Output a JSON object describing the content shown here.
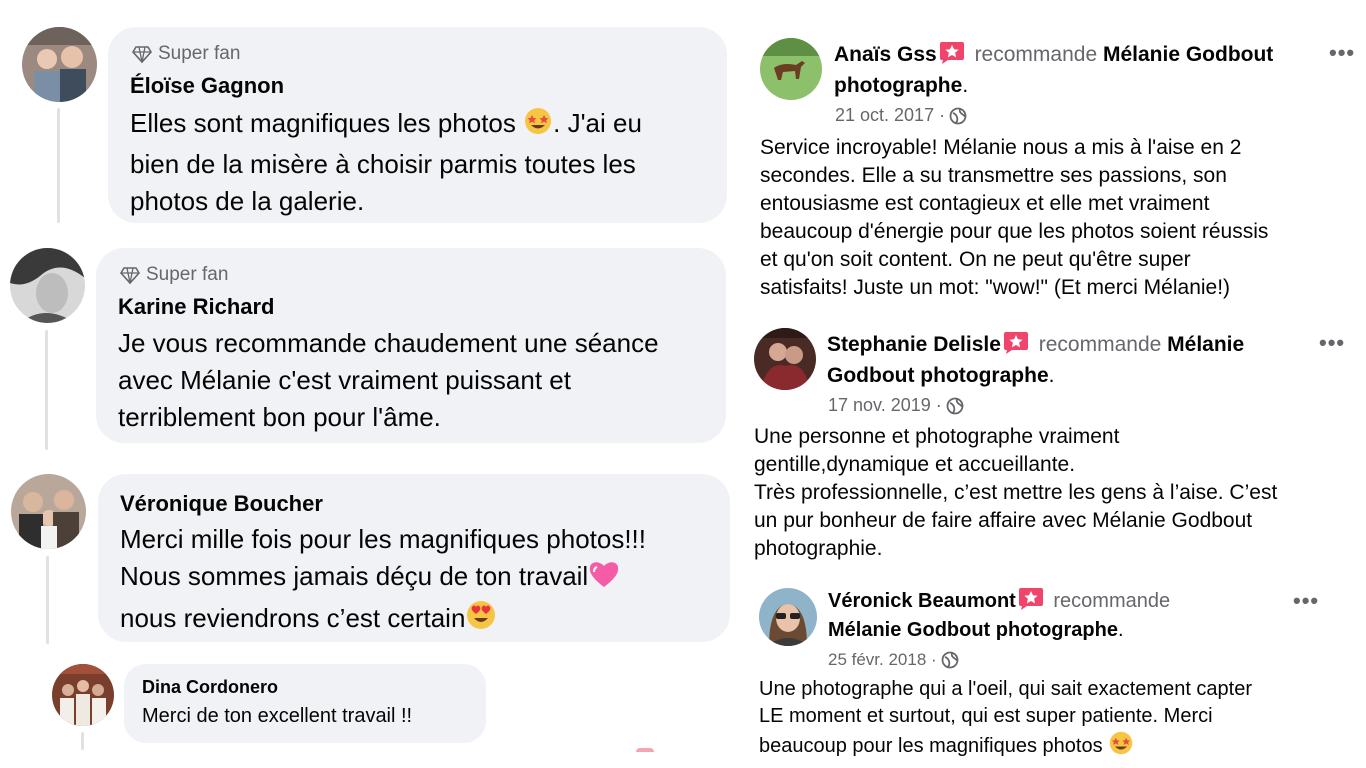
{
  "comments": [
    {
      "name": "Éloïse Gagnon",
      "badge": "Super fan",
      "text_l1": "Elles sont magnifiques les photos",
      "text_l1b": ".  J'ai eu",
      "text_l2": "bien de la misère à choisir parmis toutes les",
      "text_l3": "photos de la galerie.",
      "emoji": "star-struck-emoji"
    },
    {
      "name": "Karine Richard",
      "badge": "Super fan",
      "text_l1": "Je vous recommande chaudement une séance",
      "text_l2": "avec Mélanie c'est vraiment puissant et",
      "text_l3": "terriblement bon pour l'âme."
    },
    {
      "name": "Véronique Boucher",
      "text_l1": "Merci mille fois pour les magnifiques photos!!!",
      "text_l2": "Nous sommes jamais déçu de ton travail",
      "text_l3": "nous reviendrons c’est certain",
      "emoji1": "pink-heart-emoji",
      "emoji2": "heart-eyes-emoji"
    },
    {
      "name": "Dina Cordonero",
      "text": "Merci de ton excellent travail !!"
    }
  ],
  "reviews": [
    {
      "name": "Anaïs Gss",
      "recommends": "recommande",
      "page_l1": "Mélanie Godbout",
      "page_l2": "photographe",
      "date": "21 oct. 2017 ·",
      "text": [
        "Service incroyable! Mélanie nous a mis à l'aise en 2",
        "secondes. Elle a su transmettre ses passions, son",
        "entousiasme est contagieux et elle met vraiment",
        "beaucoup d'énergie pour que les photos soient réussis",
        "et qu'on soit content. On ne peut qu'être super",
        "satisfaits! Juste un mot: \"wow!\" (Et merci Mélanie!)"
      ]
    },
    {
      "name": "Stephanie Delisle",
      "recommends": "recommande",
      "page_l1": "Mélanie",
      "page_l2": "Godbout photographe",
      "date": "17 nov. 2019 ·",
      "text": [
        "Une personne et photographe vraiment",
        "gentille,dynamique et accueillante.",
        "Très professionnelle, c’est mettre les gens à l’aise. C’est",
        "un pur bonheur de faire affaire avec Mélanie Godbout",
        "photographie."
      ]
    },
    {
      "name": "Véronick Beaumont",
      "recommends": "recommande",
      "page_l2": "Mélanie Godbout photographe",
      "date": "25 févr. 2018 ·",
      "text": [
        "Une photographe qui a l'oeil, qui sait exactement capter",
        "LE moment et surtout, qui est super patiente. Merci",
        "beaucoup pour les magnifiques photos"
      ]
    }
  ],
  "dots": "•••",
  "colors": {
    "bubble": "#f0f2f5",
    "secondary_text": "#65676b",
    "recommend_flag": "#f0446a"
  }
}
